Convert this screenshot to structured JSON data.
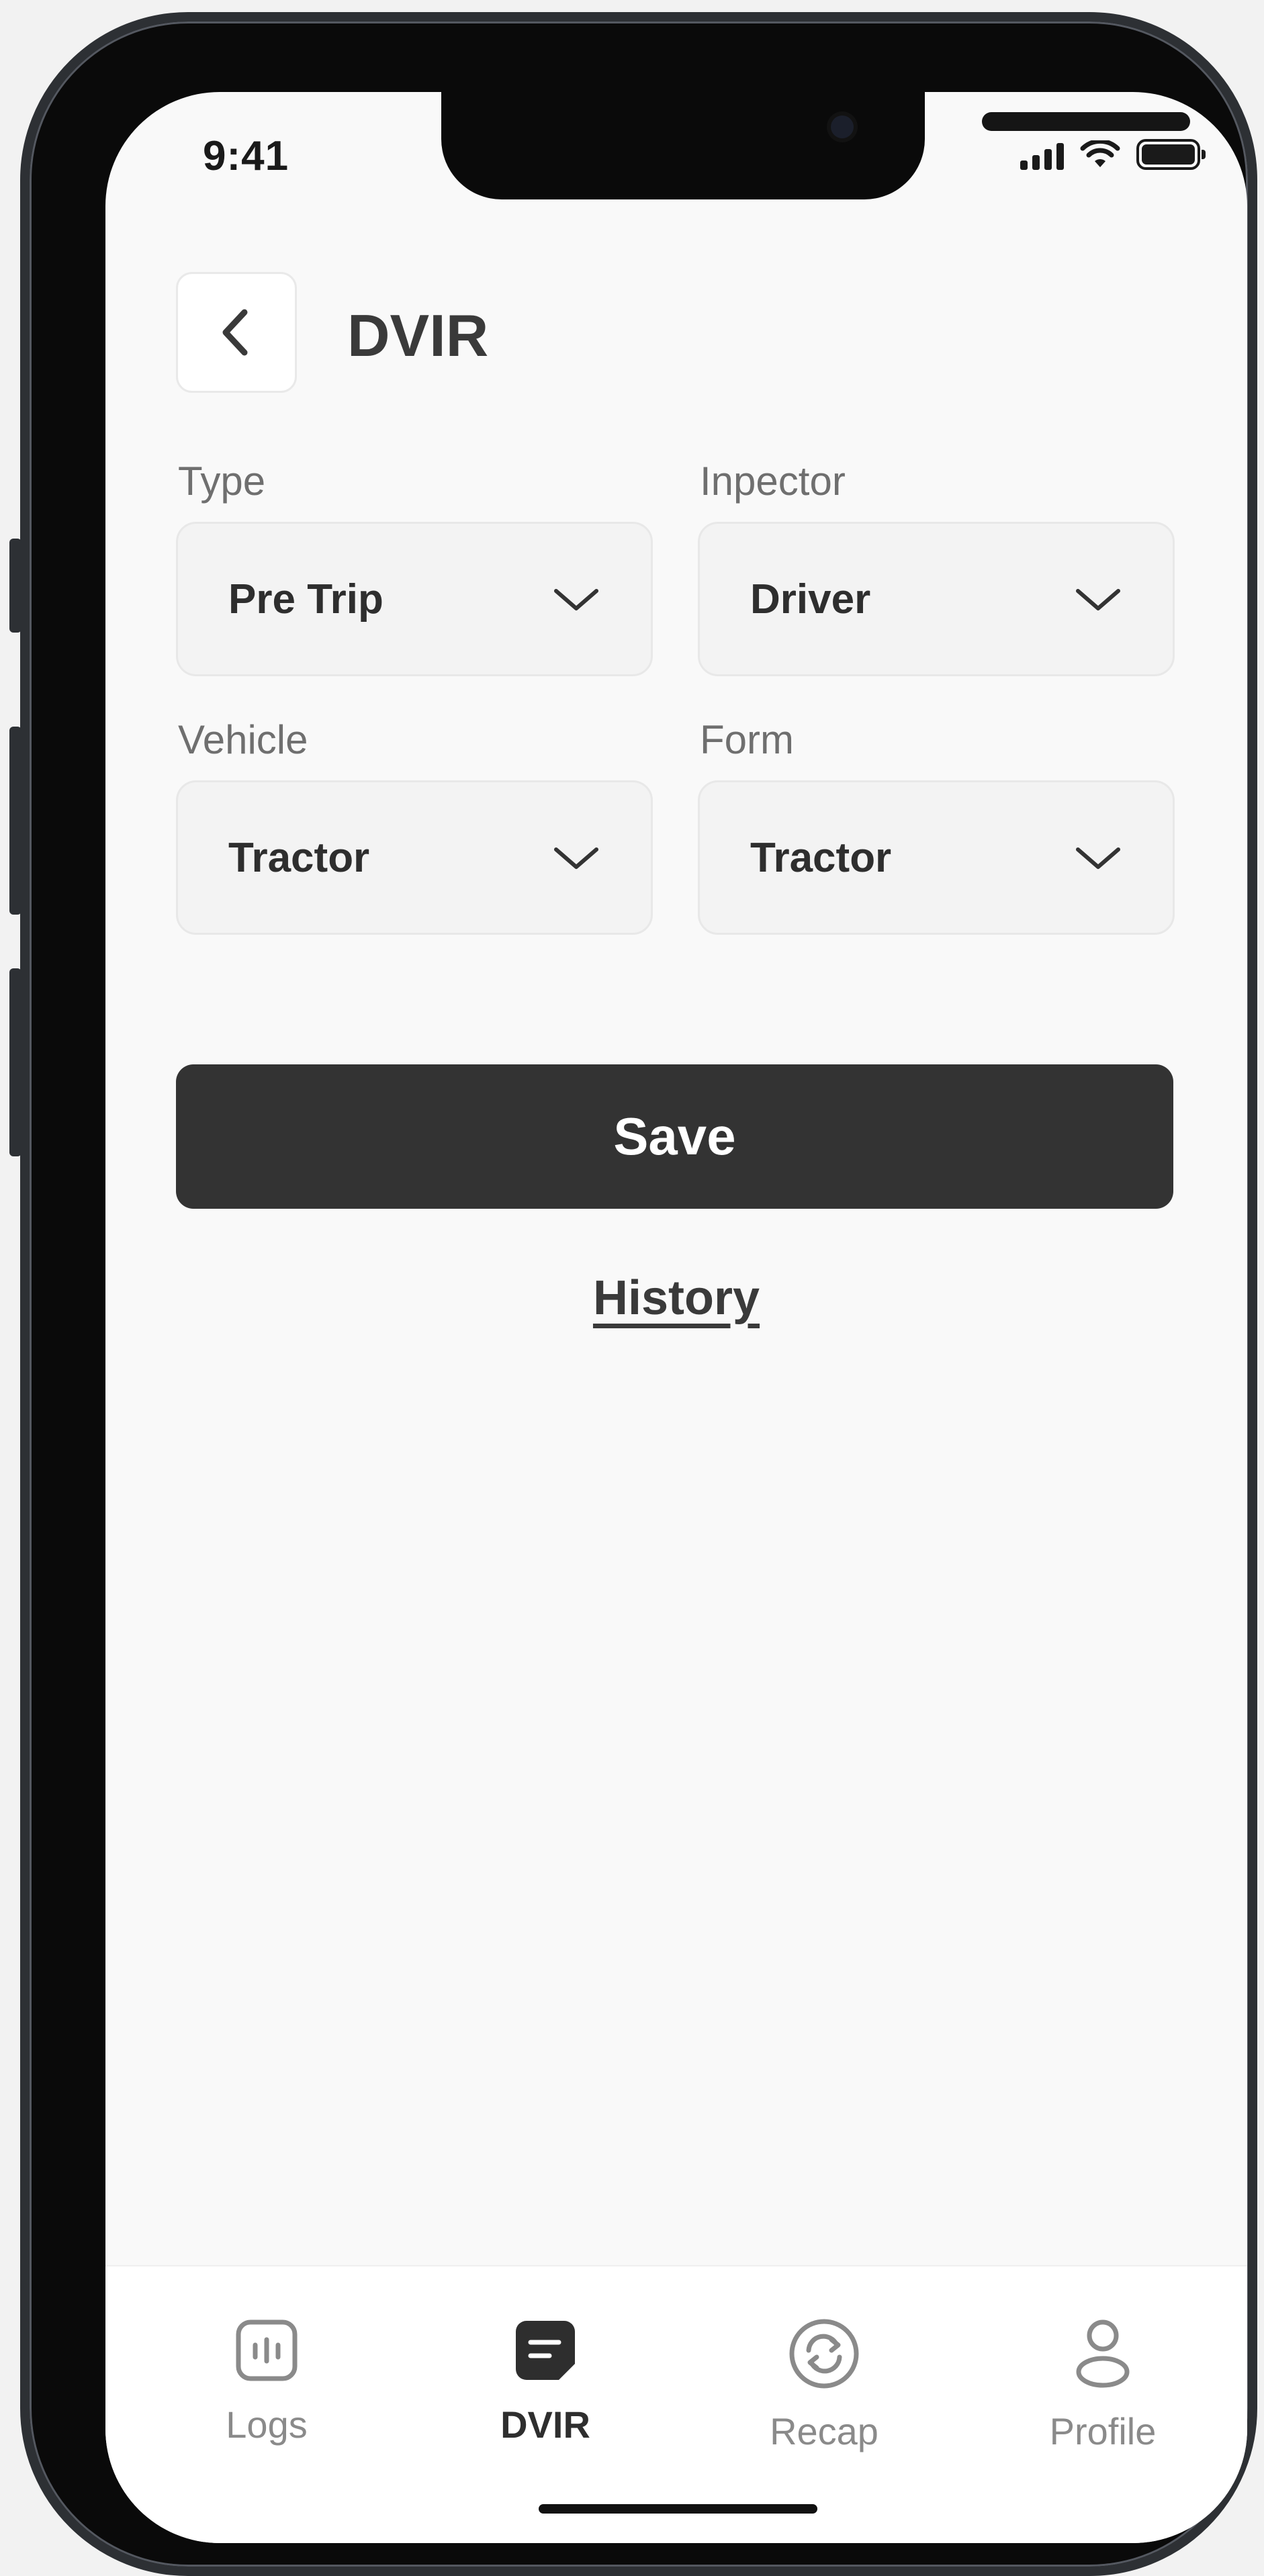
{
  "status_bar": {
    "time": "9:41"
  },
  "header": {
    "title": "DVIR",
    "back_icon": "chevron-left-icon"
  },
  "form": {
    "type": {
      "label": "Type",
      "value": "Pre Trip"
    },
    "inspector": {
      "label": "Inpector",
      "value": "Driver"
    },
    "vehicle": {
      "label": "Vehicle",
      "value": "Tractor"
    },
    "form": {
      "label": "Form",
      "value": "Tractor"
    }
  },
  "actions": {
    "save_label": "Save",
    "history_label": "History"
  },
  "tabbar": {
    "items": [
      {
        "label": "Logs",
        "icon": "logs-icon",
        "active": false
      },
      {
        "label": "DVIR",
        "icon": "dvir-document-icon",
        "active": true
      },
      {
        "label": "Recap",
        "icon": "recap-refresh-icon",
        "active": false
      },
      {
        "label": "Profile",
        "icon": "profile-icon",
        "active": false
      }
    ]
  },
  "colors": {
    "primary_button": "#333333",
    "background": "#f9f9f9",
    "field": "#f3f3f3"
  }
}
